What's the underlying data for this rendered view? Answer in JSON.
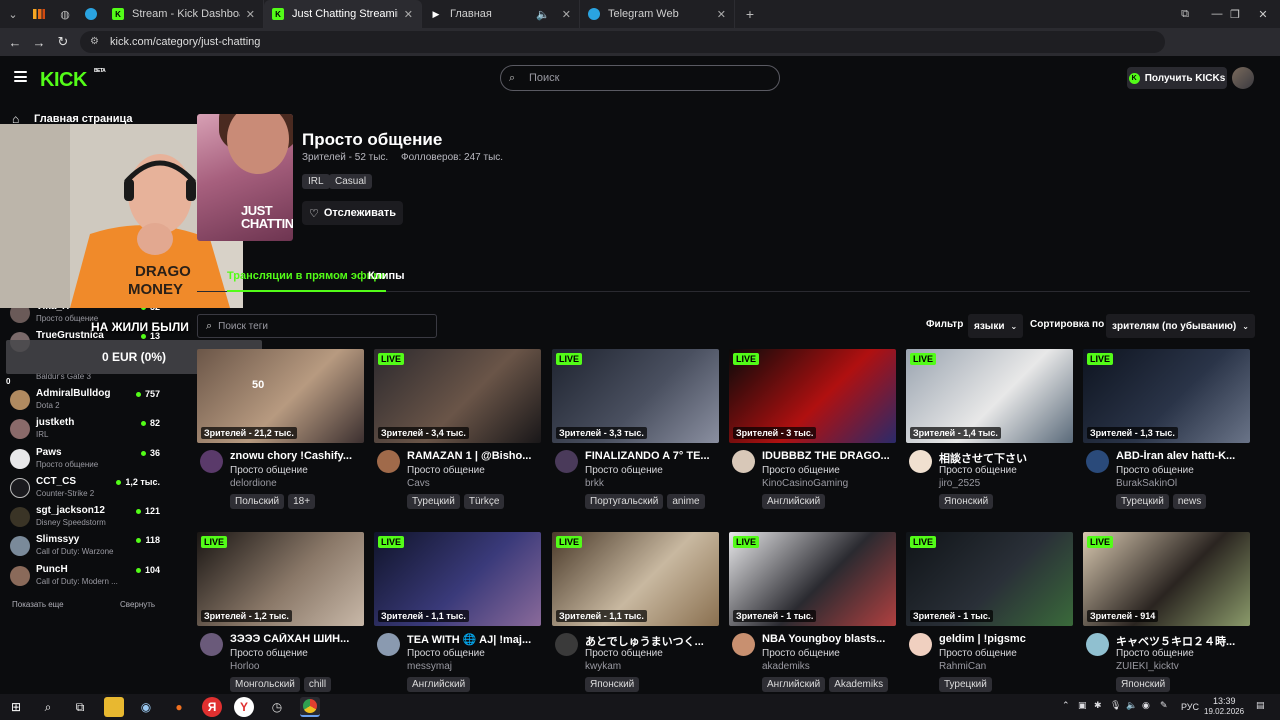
{
  "browser": {
    "tabs": [
      {
        "title": "Stream - Kick Dashboard",
        "active": false
      },
      {
        "title": "Just Chatting Streaming - Live",
        "active": true
      },
      {
        "title": "Главная",
        "active": false
      },
      {
        "title": "Telegram Web",
        "active": false
      }
    ],
    "url": "kick.com/category/just-chatting"
  },
  "header": {
    "logo": "KICK",
    "logo_badge": "BETA",
    "search_placeholder": "Поиск",
    "get_kicks": "Получить KICKs"
  },
  "sidebar": {
    "home": "Главная страница",
    "channels": [
      {
        "name": "Vika_H",
        "category": "Просто общение",
        "viewers": "52"
      },
      {
        "name": "TrueGrustnica",
        "category": "",
        "viewers": "13"
      },
      {
        "name": "",
        "category": "Baldur's Gate 3",
        "viewers": ""
      },
      {
        "name": "AdmiralBulldog",
        "category": "Dota 2",
        "viewers": "757"
      },
      {
        "name": "justketh",
        "category": "IRL",
        "viewers": "82"
      },
      {
        "name": "Paws",
        "category": "Просто общение",
        "viewers": "36"
      },
      {
        "name": "CCT_CS",
        "category": "Counter-Strike 2",
        "viewers": "1,2 тыс."
      },
      {
        "name": "sgt_jackson12",
        "category": "Disney Speedstorm",
        "viewers": "121"
      },
      {
        "name": "Slimssyy",
        "category": "Call of Duty: Warzone",
        "viewers": "118"
      },
      {
        "name": "PuncH",
        "category": "Call of Duty: Modern ...",
        "viewers": "104"
      }
    ],
    "show_more": "Показать еще",
    "collapse": "Свернуть"
  },
  "overlay": {
    "caption": "НА ЖИЛИ БЫЛИ",
    "goal": "0 EUR (0%)",
    "small": "0"
  },
  "category": {
    "image_text": "JUST CHATTING",
    "title": "Просто общение",
    "viewers": "Зрителей - 52 тыс.",
    "followers": "Фолловеров: 247 тыс.",
    "tags": [
      "IRL",
      "Casual"
    ],
    "follow": "Отслеживать"
  },
  "tabs": {
    "live": "Трансляции в прямом эфире",
    "clips": "Клипы"
  },
  "filters": {
    "tag_search_placeholder": "Поиск теги",
    "filter_label": "Фильтр",
    "language": "языки",
    "sort_label": "Сортировка по",
    "sort_value": "зрителям (по убыванию)"
  },
  "live_label": "LIVE",
  "streams": [
    {
      "title": "znowu chory !Cashify...",
      "category": "Просто общение",
      "channel": "delordione",
      "viewers": "Зрителей - 21,2 тыс.",
      "tags": [
        "Польский",
        "18+"
      ],
      "live": false,
      "thumb_text": "50",
      "colors": [
        "#6b5648",
        "#b79a80",
        "#3c3030"
      ]
    },
    {
      "title": "RAMAZAN 1 | @Bisho...",
      "category": "Просто общение",
      "channel": "Cavs",
      "viewers": "Зрителей - 3,4 тыс.",
      "tags": [
        "Турецкий",
        "Türkçe"
      ],
      "live": true,
      "colors": [
        "#2d2a2e",
        "#6a5548",
        "#191719"
      ]
    },
    {
      "title": "FINALIZANDO A 7° TE...",
      "category": "Просто общение",
      "channel": "brkk",
      "viewers": "Зрителей - 3,3 тыс.",
      "tags": [
        "Португальский",
        "anime"
      ],
      "live": true,
      "colors": [
        "#1f2430",
        "#4a5060",
        "#8a8fa0"
      ]
    },
    {
      "title": "IDUBBBZ THE DRAGO...",
      "category": "Просто общение",
      "channel": "KinoCasinoGaming",
      "viewers": "Зрителей - 3 тыс.",
      "tags": [
        "Английский"
      ],
      "live": true,
      "colors": [
        "#0a0a0a",
        "#b01010",
        "#2a2a6a"
      ]
    },
    {
      "title": "相談させて下さい",
      "category": "Просто общение",
      "channel": "jiro_2525",
      "viewers": "Зрителей - 1,4 тыс.",
      "tags": [
        "Японский"
      ],
      "live": true,
      "colors": [
        "#9aa4b0",
        "#e8e8e8",
        "#5a6a7a"
      ]
    },
    {
      "title": "ABD-İran alev hattı-K...",
      "category": "Просто общение",
      "channel": "BurakSakinOl",
      "viewers": "Зрителей - 1,3 тыс.",
      "tags": [
        "Турецкий",
        "news"
      ],
      "live": true,
      "colors": [
        "#0e1420",
        "#2a3448",
        "#6a7488"
      ]
    },
    {
      "title": "ЗЭЭЭ САЙХАН ШИН...",
      "category": "Просто общение",
      "channel": "Horloo",
      "viewers": "Зрителей - 1,2 тыс.",
      "tags": [
        "Монгольский",
        "chill"
      ],
      "live": true,
      "colors": [
        "#1a1614",
        "#8a7868",
        "#c8b8a8"
      ]
    },
    {
      "title": "TEA WITH 🌐 AJ| !maj...",
      "category": "Просто общение",
      "channel": "messymaj",
      "viewers": "Зрителей - 1,1 тыс.",
      "tags": [
        "Английский"
      ],
      "live": true,
      "colors": [
        "#10142a",
        "#3a3a7a",
        "#8a6a9a"
      ]
    },
    {
      "title": "あとでしゅうまいつく...",
      "category": "Просто общение",
      "channel": "kwykam",
      "viewers": "Зрителей - 1,1 тыс.",
      "tags": [
        "Японский"
      ],
      "live": true,
      "colors": [
        "#4a3a2a",
        "#c8b8a0",
        "#8a7050"
      ]
    },
    {
      "title": "NBA Youngboy blasts...",
      "category": "Просто общение",
      "channel": "akademiks",
      "viewers": "Зрителей - 1 тыс.",
      "tags": [
        "Английский",
        "Akademiks"
      ],
      "live": true,
      "colors": [
        "#e8e8ea",
        "#2a2a30",
        "#b04040"
      ]
    },
    {
      "title": "geldim | !pigsmc",
      "category": "Просто общение",
      "channel": "RahmiCan",
      "viewers": "Зрителей - 1 тыс.",
      "tags": [
        "Турецкий"
      ],
      "live": true,
      "colors": [
        "#101418",
        "#2a3038",
        "#3a6a3a"
      ]
    },
    {
      "title": "キャベツ５キロ２４時...",
      "category": "Просто общение",
      "channel": "ZUIEKI_kicktv",
      "viewers": "Зрителей - 914",
      "tags": [
        "Японский"
      ],
      "live": true,
      "colors": [
        "#d8c8b0",
        "#2a2420",
        "#8a9a6a"
      ]
    }
  ],
  "taskbar": {
    "lang": "РУС",
    "time": "13:39",
    "date": "19.02.2026"
  }
}
